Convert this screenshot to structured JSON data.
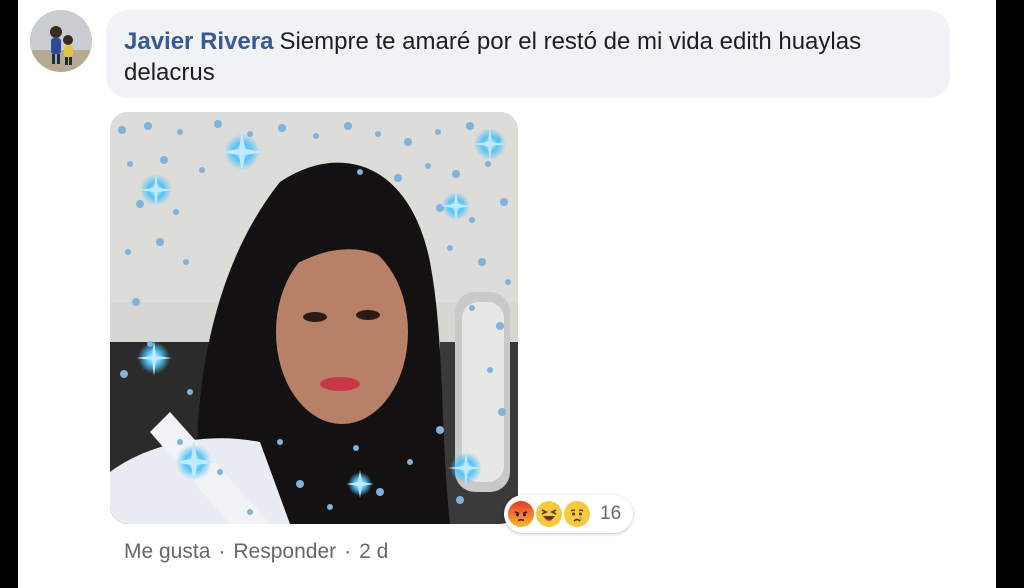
{
  "comment": {
    "author": "Javier Rivera",
    "text": "Siempre te amaré por el restó de mi vida edith huaylas delacrus",
    "reactions": {
      "icons": [
        "angry-icon",
        "haha-icon",
        "sad-icon"
      ],
      "count": "16"
    },
    "actions": {
      "like_label": "Me gusta",
      "separator": "·",
      "reply_label": "Responder",
      "time": "2 d"
    }
  },
  "colors": {
    "author": "#385898",
    "bubble": "#f0f2f5",
    "meta_text": "#65676b",
    "frame": "#000000"
  }
}
